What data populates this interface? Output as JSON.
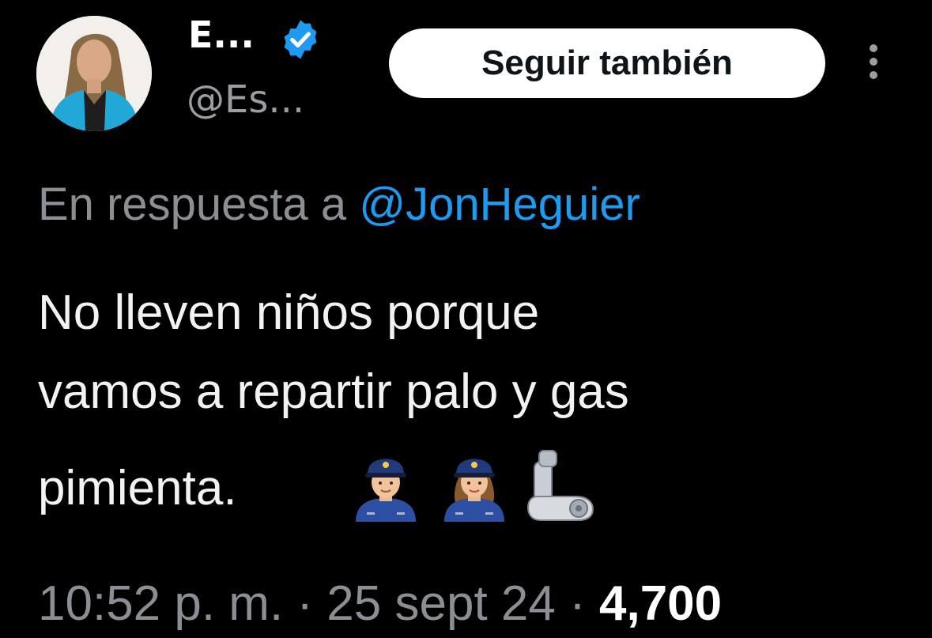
{
  "author": {
    "display_name": "E...",
    "handle": "@Es...",
    "verified": true,
    "avatar": "avatar-photo"
  },
  "follow_button": {
    "label": "Seguir también"
  },
  "more_menu": {
    "icon": "more-vertical-icon"
  },
  "reply_context": {
    "prefix": "En respuesta a",
    "mention": "@JonHeguier"
  },
  "tweet": {
    "lines": [
      "No lleven niños porque",
      "vamos a repartir palo y gas",
      "pimienta."
    ],
    "emojis": [
      "police-officer-man-icon",
      "police-officer-woman-icon",
      "mechanical-arm-icon"
    ]
  },
  "meta": {
    "time": "10:52 p. m.",
    "sep1": " · ",
    "date": "25 sept 24",
    "sep2": " · ",
    "views": "4,700"
  },
  "colors": {
    "background": "#000000",
    "link": "#1d9bf0",
    "secondary": "#8b8f93",
    "verified": "#1d9bf0"
  }
}
